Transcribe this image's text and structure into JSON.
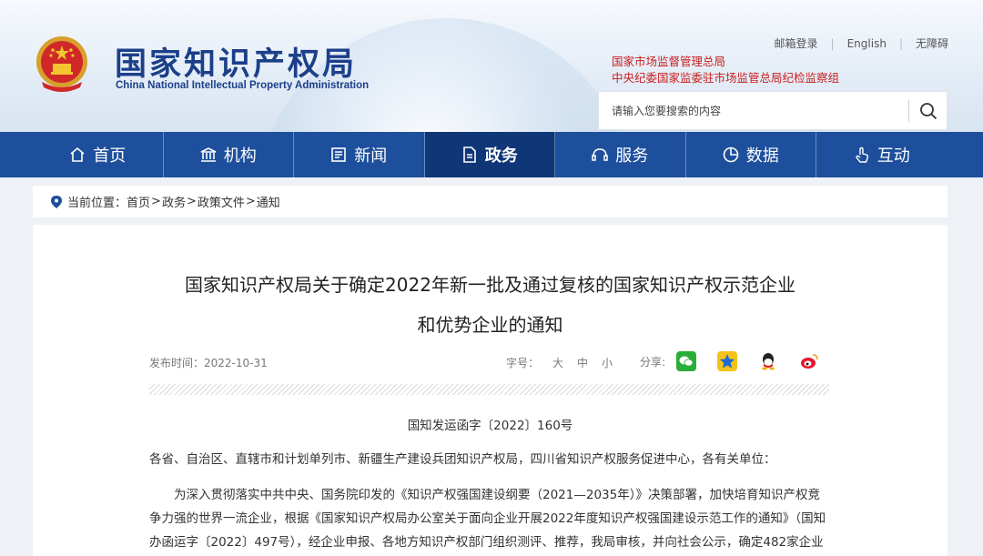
{
  "header": {
    "title_cn": "国家知识产权局",
    "title_en": "China National Intellectual Property Administration",
    "links": [
      "邮箱登录",
      "English",
      "无障碍"
    ],
    "supervisors": [
      "国家市场监督管理总局",
      "中央纪委国家监委驻市场监管总局纪检监察组"
    ]
  },
  "search": {
    "placeholder": "请输入您要搜索的内容"
  },
  "nav": {
    "items": [
      {
        "label": "首页",
        "icon": "home-icon"
      },
      {
        "label": "机构",
        "icon": "institution-icon"
      },
      {
        "label": "新闻",
        "icon": "news-icon"
      },
      {
        "label": "政务",
        "icon": "document-icon",
        "active": true
      },
      {
        "label": "服务",
        "icon": "service-icon"
      },
      {
        "label": "数据",
        "icon": "pie-chart-icon"
      },
      {
        "label": "互动",
        "icon": "hand-pointer-icon"
      }
    ]
  },
  "breadcrumb": {
    "prefix": "当前位置：",
    "items": [
      "首页",
      "政务",
      "政策文件",
      "通知"
    ],
    "separator": ">"
  },
  "article": {
    "title_line1": "国家知识产权局关于确定2022年新一批及通过复核的国家知识产权示范企业",
    "title_line2": "和优势企业的通知",
    "publish_label": "发布时间：2022-10-31",
    "fontsize_label": "字号：",
    "fontsize_options": [
      "大",
      "中",
      "小"
    ],
    "share_label": "分享:",
    "share_icons": [
      "wechat-icon",
      "qzone-icon",
      "qq-icon",
      "weibo-icon"
    ],
    "doc_number": "国知发运函字〔2022〕160号",
    "para1": "各省、自治区、直辖市和计划单列市、新疆生产建设兵团知识产权局，四川省知识产权服务促进中心，各有关单位：",
    "para2": "为深入贯彻落实中共中央、国务院印发的《知识产权强国建设纲要（2021—2035年）》决策部署，加快培育知识产权竞争力强的世界一流企业，根据《国家知识产权局办公室关于面向企业开展2022年度知识产权强国建设示范工作的通知》（国知办函运字〔2022〕497号），经企业申报、各地方知识产权部门组织测评、推荐，我局审核，并向社会公示，确定482家企业"
  },
  "colors": {
    "brand": "#1d4f9c",
    "nav_active": "#0f3677",
    "supervisor_red": "#c81e1e",
    "logo_blue": "#1c3f8a"
  }
}
